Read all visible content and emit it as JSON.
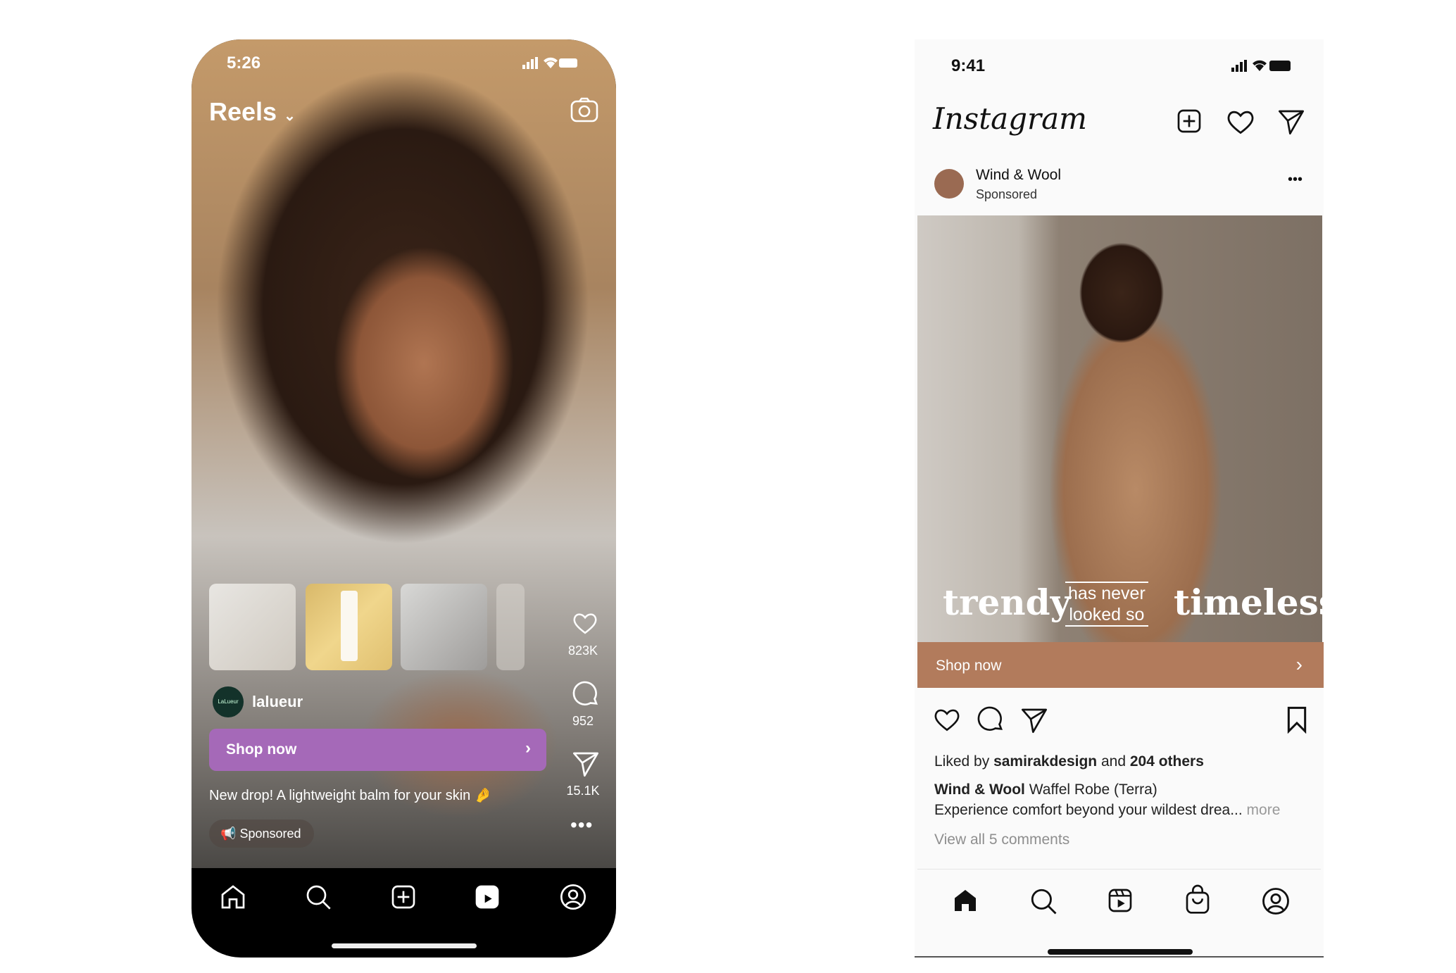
{
  "reels": {
    "status_time": "5:26",
    "title": "Reels",
    "account": "lalueur",
    "avatar_text": "LaLueur",
    "shop_label": "Shop now",
    "caption": "New drop! A lightweight balm for your skin 🤌",
    "sponsored": "Sponsored",
    "likes": "823K",
    "comments": "952",
    "shares": "15.1K",
    "accent": "#a569b8",
    "nav": [
      "home-icon",
      "search-icon",
      "create-icon",
      "reels-icon",
      "profile-icon"
    ]
  },
  "feed": {
    "status_time": "9:41",
    "logo": "Instagram",
    "account": "Wind & Wool",
    "sponsored": "Sponsored",
    "overlay": {
      "left": "trendy",
      "middle_1": "has never",
      "middle_2": "looked so",
      "right": "timeless"
    },
    "shop_label": "Shop now",
    "accent": "#b27b5c",
    "liked_prefix": "Liked by ",
    "liked_user": "samirakdesign",
    "liked_mid": " and ",
    "liked_count": "204 others",
    "caption_user": "Wind & Wool",
    "caption_title": " Waffel Robe (Terra)",
    "caption_text": "Experience comfort beyond your wildest drea...",
    "more": " more",
    "view_comments": "View all 5 comments",
    "nav": [
      "home-icon",
      "search-icon",
      "reels-icon",
      "shop-icon",
      "profile-icon"
    ]
  }
}
